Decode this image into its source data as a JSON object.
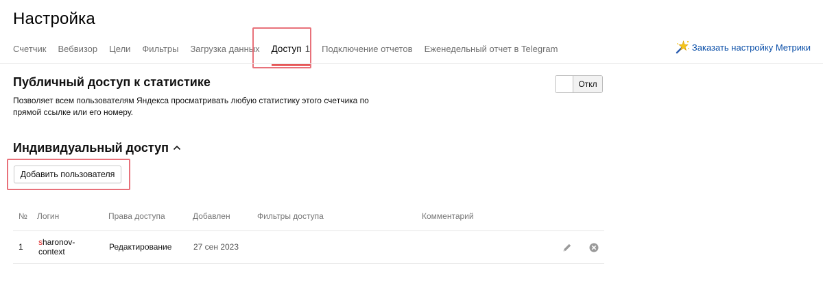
{
  "page": {
    "title": "Настройка"
  },
  "tabs": [
    {
      "label": "Счетчик"
    },
    {
      "label": "Вебвизор"
    },
    {
      "label": "Цели"
    },
    {
      "label": "Фильтры"
    },
    {
      "label": "Загрузка данных"
    },
    {
      "label": "Доступ",
      "count": "1",
      "active": true
    },
    {
      "label": "Подключение отчетов"
    },
    {
      "label": "Еженедельный отчет в Telegram"
    }
  ],
  "order_link": {
    "label": "Заказать настройку Метрики",
    "icon": "magic-wand-icon",
    "color": "#0b4fa8"
  },
  "public_access": {
    "title": "Публичный доступ к статистике",
    "description": "Позволяет всем пользователям Яндекса просматривать любую статистику этого счетчика по прямой ссылке или его номеру.",
    "toggle_state": "Откл",
    "enabled": false
  },
  "individual_access": {
    "title": "Индивидуальный доступ",
    "expanded": true,
    "add_button": "Добавить пользователя"
  },
  "table": {
    "columns": [
      "№",
      "Логин",
      "Права доступа",
      "Добавлен",
      "Фильтры доступа",
      "Комментарий"
    ],
    "rows": [
      {
        "num": "1",
        "login_first": "s",
        "login_rest_line1": "haronov-",
        "login_line2": "context",
        "rights": "Редактирование",
        "added": "27 сен 2023",
        "filters": "",
        "comment": "",
        "actions": [
          "pencil-icon",
          "close-circle-icon"
        ]
      }
    ]
  },
  "colors": {
    "accent_red": "#e02f2f",
    "highlight": "#e8717a",
    "link": "#0b4fa8"
  }
}
